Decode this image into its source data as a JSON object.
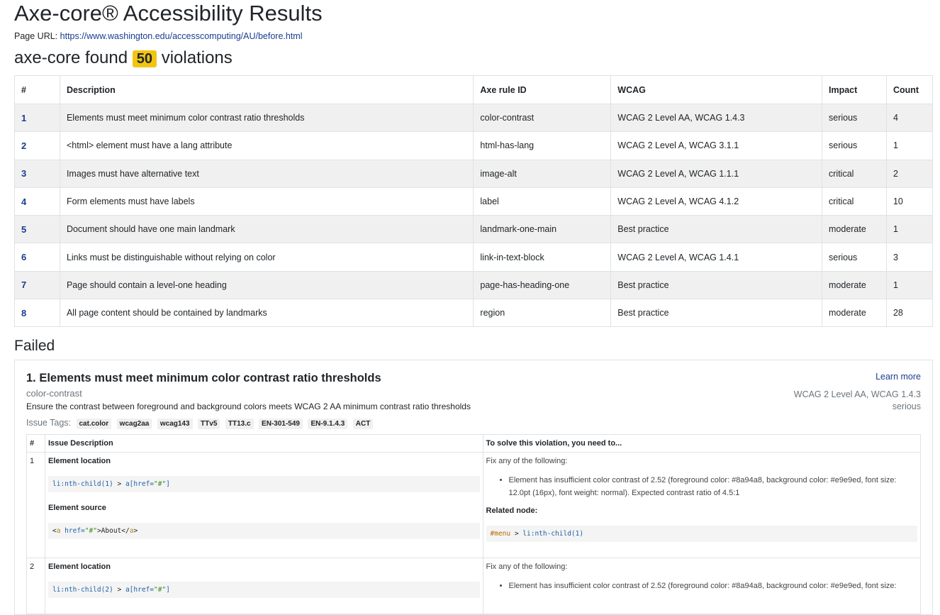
{
  "title": "Axe-core® Accessibility Results",
  "page_url_label": "Page URL:",
  "page_url": "https://www.washington.edu/accesscomputing/AU/before.html",
  "found_prefix": "axe-core found",
  "violation_count": "50",
  "found_suffix": "violations",
  "summary": {
    "headers": [
      "#",
      "Description",
      "Axe rule ID",
      "WCAG",
      "Impact",
      "Count"
    ],
    "rows": [
      {
        "idx": "1",
        "description": "Elements must meet minimum color contrast ratio thresholds",
        "rule": "color-contrast",
        "wcag": "WCAG 2 Level AA, WCAG 1.4.3",
        "impact": "serious",
        "count": "4"
      },
      {
        "idx": "2",
        "description": "<html> element must have a lang attribute",
        "rule": "html-has-lang",
        "wcag": "WCAG 2 Level A, WCAG 3.1.1",
        "impact": "serious",
        "count": "1"
      },
      {
        "idx": "3",
        "description": "Images must have alternative text",
        "rule": "image-alt",
        "wcag": "WCAG 2 Level A, WCAG 1.1.1",
        "impact": "critical",
        "count": "2"
      },
      {
        "idx": "4",
        "description": "Form elements must have labels",
        "rule": "label",
        "wcag": "WCAG 2 Level A, WCAG 4.1.2",
        "impact": "critical",
        "count": "10"
      },
      {
        "idx": "5",
        "description": "Document should have one main landmark",
        "rule": "landmark-one-main",
        "wcag": "Best practice",
        "impact": "moderate",
        "count": "1"
      },
      {
        "idx": "6",
        "description": "Links must be distinguishable without relying on color",
        "rule": "link-in-text-block",
        "wcag": "WCAG 2 Level A, WCAG 1.4.1",
        "impact": "serious",
        "count": "3"
      },
      {
        "idx": "7",
        "description": "Page should contain a level-one heading",
        "rule": "page-has-heading-one",
        "wcag": "Best practice",
        "impact": "moderate",
        "count": "1"
      },
      {
        "idx": "8",
        "description": "All page content should be contained by landmarks",
        "rule": "region",
        "wcag": "Best practice",
        "impact": "moderate",
        "count": "28"
      }
    ]
  },
  "failed_heading": "Failed",
  "card": {
    "title": "1. Elements must meet minimum color contrast ratio thresholds",
    "learn_more": "Learn more",
    "rule_id": "color-contrast",
    "wcag": "WCAG 2 Level AA, WCAG 1.4.3",
    "impact": "serious",
    "description": "Ensure the contrast between foreground and background colors meets WCAG 2 AA minimum contrast ratio thresholds",
    "tags_label": "Issue Tags:",
    "tags": [
      "cat.color",
      "wcag2aa",
      "wcag143",
      "TTv5",
      "TT13.c",
      "EN-301-549",
      "EN-9.1.4.3",
      "ACT"
    ],
    "detail_headers": [
      "#",
      "Issue Description",
      "To solve this violation, you need to..."
    ],
    "issues": [
      {
        "num": "1",
        "location_label": "Element location",
        "selector_a": "li:nth-child(1)",
        "selector_sep": " > ",
        "selector_b": "a[href=",
        "selector_str": "\"#\"",
        "selector_end": "]",
        "source_label": "Element source",
        "src_open": "<",
        "src_tag": "a",
        "src_attr": " href=",
        "src_val": "\"#\"",
        "src_text": ">About</",
        "src_tag_close": "a",
        "src_end": ">",
        "fix_intro": "Fix any of the following:",
        "fix_item": "Element has insufficient color contrast of 2.52 (foreground color: #8a94a8, background color: #e9e9ed, font size: 12.0pt (16px), font weight: normal). Expected contrast ratio of 4.5:1",
        "related_label": "Related node:",
        "related_hash": "#menu",
        "related_sep": " > ",
        "related_sel": "li:nth-child(1)"
      },
      {
        "num": "2",
        "location_label": "Element location",
        "selector_a": "li:nth-child(2)",
        "selector_sep": " > ",
        "selector_b": "a[href=",
        "selector_str": "\"#\"",
        "selector_end": "]",
        "fix_intro": "Fix any of the following:",
        "fix_item": "Element has insufficient color contrast of 2.52 (foreground color: #8a94a8, background color: #e9e9ed, font size:"
      }
    ]
  },
  "colors": {
    "badge": "#f2c511",
    "link": "#1a3d8f",
    "muted": "#6c757d",
    "row_stripe": "#f0f0f0"
  }
}
